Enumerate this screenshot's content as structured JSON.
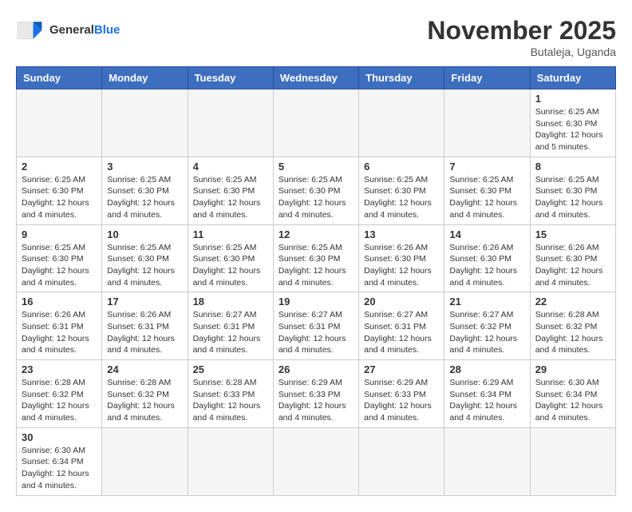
{
  "header": {
    "logo_general": "General",
    "logo_blue": "Blue",
    "month_year": "November 2025",
    "location": "Butaleja, Uganda"
  },
  "weekdays": [
    "Sunday",
    "Monday",
    "Tuesday",
    "Wednesday",
    "Thursday",
    "Friday",
    "Saturday"
  ],
  "weeks": [
    [
      {
        "day": "",
        "info": ""
      },
      {
        "day": "",
        "info": ""
      },
      {
        "day": "",
        "info": ""
      },
      {
        "day": "",
        "info": ""
      },
      {
        "day": "",
        "info": ""
      },
      {
        "day": "",
        "info": ""
      },
      {
        "day": "1",
        "info": "Sunrise: 6:25 AM\nSunset: 6:30 PM\nDaylight: 12 hours and 5 minutes."
      }
    ],
    [
      {
        "day": "2",
        "info": "Sunrise: 6:25 AM\nSunset: 6:30 PM\nDaylight: 12 hours and 4 minutes."
      },
      {
        "day": "3",
        "info": "Sunrise: 6:25 AM\nSunset: 6:30 PM\nDaylight: 12 hours and 4 minutes."
      },
      {
        "day": "4",
        "info": "Sunrise: 6:25 AM\nSunset: 6:30 PM\nDaylight: 12 hours and 4 minutes."
      },
      {
        "day": "5",
        "info": "Sunrise: 6:25 AM\nSunset: 6:30 PM\nDaylight: 12 hours and 4 minutes."
      },
      {
        "day": "6",
        "info": "Sunrise: 6:25 AM\nSunset: 6:30 PM\nDaylight: 12 hours and 4 minutes."
      },
      {
        "day": "7",
        "info": "Sunrise: 6:25 AM\nSunset: 6:30 PM\nDaylight: 12 hours and 4 minutes."
      },
      {
        "day": "8",
        "info": "Sunrise: 6:25 AM\nSunset: 6:30 PM\nDaylight: 12 hours and 4 minutes."
      }
    ],
    [
      {
        "day": "9",
        "info": "Sunrise: 6:25 AM\nSunset: 6:30 PM\nDaylight: 12 hours and 4 minutes."
      },
      {
        "day": "10",
        "info": "Sunrise: 6:25 AM\nSunset: 6:30 PM\nDaylight: 12 hours and 4 minutes."
      },
      {
        "day": "11",
        "info": "Sunrise: 6:25 AM\nSunset: 6:30 PM\nDaylight: 12 hours and 4 minutes."
      },
      {
        "day": "12",
        "info": "Sunrise: 6:25 AM\nSunset: 6:30 PM\nDaylight: 12 hours and 4 minutes."
      },
      {
        "day": "13",
        "info": "Sunrise: 6:26 AM\nSunset: 6:30 PM\nDaylight: 12 hours and 4 minutes."
      },
      {
        "day": "14",
        "info": "Sunrise: 6:26 AM\nSunset: 6:30 PM\nDaylight: 12 hours and 4 minutes."
      },
      {
        "day": "15",
        "info": "Sunrise: 6:26 AM\nSunset: 6:30 PM\nDaylight: 12 hours and 4 minutes."
      }
    ],
    [
      {
        "day": "16",
        "info": "Sunrise: 6:26 AM\nSunset: 6:31 PM\nDaylight: 12 hours and 4 minutes."
      },
      {
        "day": "17",
        "info": "Sunrise: 6:26 AM\nSunset: 6:31 PM\nDaylight: 12 hours and 4 minutes."
      },
      {
        "day": "18",
        "info": "Sunrise: 6:27 AM\nSunset: 6:31 PM\nDaylight: 12 hours and 4 minutes."
      },
      {
        "day": "19",
        "info": "Sunrise: 6:27 AM\nSunset: 6:31 PM\nDaylight: 12 hours and 4 minutes."
      },
      {
        "day": "20",
        "info": "Sunrise: 6:27 AM\nSunset: 6:31 PM\nDaylight: 12 hours and 4 minutes."
      },
      {
        "day": "21",
        "info": "Sunrise: 6:27 AM\nSunset: 6:32 PM\nDaylight: 12 hours and 4 minutes."
      },
      {
        "day": "22",
        "info": "Sunrise: 6:28 AM\nSunset: 6:32 PM\nDaylight: 12 hours and 4 minutes."
      }
    ],
    [
      {
        "day": "23",
        "info": "Sunrise: 6:28 AM\nSunset: 6:32 PM\nDaylight: 12 hours and 4 minutes."
      },
      {
        "day": "24",
        "info": "Sunrise: 6:28 AM\nSunset: 6:32 PM\nDaylight: 12 hours and 4 minutes."
      },
      {
        "day": "25",
        "info": "Sunrise: 6:28 AM\nSunset: 6:33 PM\nDaylight: 12 hours and 4 minutes."
      },
      {
        "day": "26",
        "info": "Sunrise: 6:29 AM\nSunset: 6:33 PM\nDaylight: 12 hours and 4 minutes."
      },
      {
        "day": "27",
        "info": "Sunrise: 6:29 AM\nSunset: 6:33 PM\nDaylight: 12 hours and 4 minutes."
      },
      {
        "day": "28",
        "info": "Sunrise: 6:29 AM\nSunset: 6:34 PM\nDaylight: 12 hours and 4 minutes."
      },
      {
        "day": "29",
        "info": "Sunrise: 6:30 AM\nSunset: 6:34 PM\nDaylight: 12 hours and 4 minutes."
      }
    ],
    [
      {
        "day": "30",
        "info": "Sunrise: 6:30 AM\nSunset: 6:34 PM\nDaylight: 12 hours and 4 minutes."
      },
      {
        "day": "",
        "info": ""
      },
      {
        "day": "",
        "info": ""
      },
      {
        "day": "",
        "info": ""
      },
      {
        "day": "",
        "info": ""
      },
      {
        "day": "",
        "info": ""
      },
      {
        "day": "",
        "info": ""
      }
    ]
  ]
}
